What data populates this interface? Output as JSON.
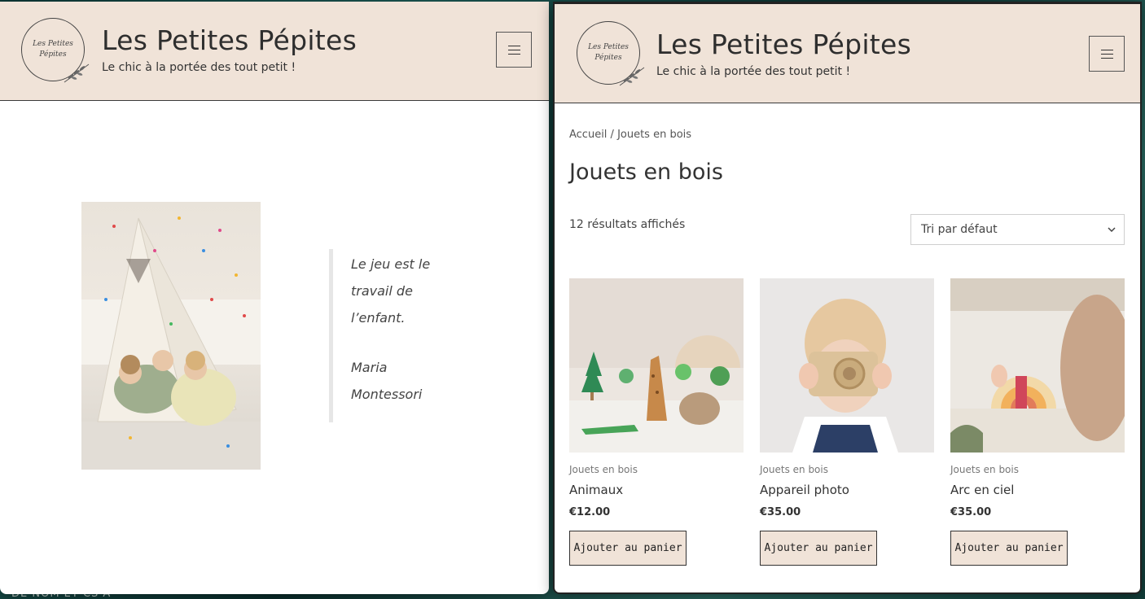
{
  "desktop": {
    "bottom_text": "DE NOM ET CS A"
  },
  "site": {
    "logo_line1": "Les Petites",
    "logo_line2": "Pépites",
    "title": "Les Petites Pépites",
    "tagline": "Le chic à la portée des tout petit !"
  },
  "home": {
    "quote_lines": [
      "Le jeu est le",
      "travail de",
      "l’enfant."
    ],
    "author_lines": [
      "Maria",
      "Montessori"
    ]
  },
  "shop": {
    "breadcrumb": "Accueil / Jouets en bois",
    "title": "Jouets en bois",
    "results": "12 résultats affichés",
    "sort_selected": "Tri par défaut",
    "products": [
      {
        "category": "Jouets en bois",
        "name": "Animaux",
        "price": "€12.00",
        "button": "Ajouter au panier"
      },
      {
        "category": "Jouets en bois",
        "name": "Appareil photo",
        "price": "€35.00",
        "button": "Ajouter au panier"
      },
      {
        "category": "Jouets en bois",
        "name": "Arc en ciel",
        "price": "€35.00",
        "button": "Ajouter au panier"
      }
    ]
  },
  "colors": {
    "header_bg": "#f0e3d8",
    "button_bg": "#f0e3d8",
    "text": "#333333"
  }
}
